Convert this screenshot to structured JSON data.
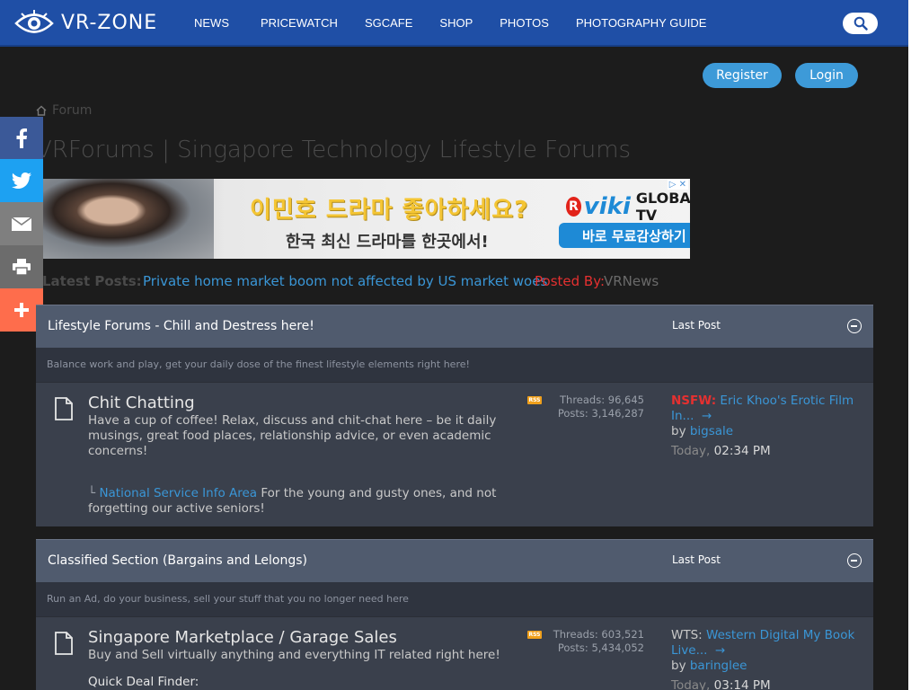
{
  "nav": {
    "logo_text": "VR-ZONE",
    "items": [
      "NEWS",
      "PRICEWATCH",
      "SGCAFE",
      "SHOP",
      "PHOTOS",
      "PHOTOGRAPHY GUIDE"
    ]
  },
  "auth": {
    "register": "Register",
    "login": "Login"
  },
  "breadcrumb": {
    "label": "Forum"
  },
  "page_title": "VRForums | Singapore Technology Lifestyle Forums",
  "ad": {
    "headline": "이민호 드라마 좋아하세요?",
    "sub": "한국 최신 드라마를 한곳에서!",
    "brand_r": "R",
    "brand_viki": "viki",
    "brand_tv": "GLOBAL TV",
    "cta": "바로 무료감상하기",
    "cta_arrow": "▶",
    "adchoice": "▷ ✕"
  },
  "latest": {
    "label": "Latest Posts:",
    "link": "Private home market boom not affected by US market woes",
    "posted_by": "Posted By:",
    "author": "VRNews"
  },
  "sections": [
    {
      "title": "Lifestyle Forums - Chill and Destress here!",
      "last_post_label": "Last Post",
      "description": "Balance work and play, get your daily dose of the finest lifestyle elements right here!",
      "forum": {
        "name": "Chit Chatting",
        "desc": "Have a cup of coffee! Relax, discuss and chit-chat here – be it daily musings, great food places, relationship advice, or even academic concerns!",
        "threads": "Threads: 96,645",
        "posts": "Posts: 3,146,287",
        "lp_prefix": "NSFW:",
        "lp_title": "Eric Khoo's Erotic Film In...",
        "lp_by": "by",
        "lp_user": "bigsale",
        "lp_day": "Today,",
        "lp_time": "02:34 PM",
        "sub_marker": "└",
        "sub_link": "National Service Info Area",
        "sub_text": "For the young and gusty ones, and not forgetting our active seniors!"
      }
    },
    {
      "title": "Classified Section (Bargains and Lelongs)",
      "last_post_label": "Last Post",
      "description": "Run an Ad, do your business, sell your stuff that you no longer need here",
      "forum": {
        "name": "Singapore Marketplace / Garage Sales",
        "desc": "Buy and Sell virtually anything and everything IT related right here!",
        "threads": "Threads: 603,521",
        "posts": "Posts: 5,434,052",
        "lp_prefix": "WTS:",
        "lp_title": "Western Digital My Book Live...",
        "lp_by": "by",
        "lp_user": "baringlee",
        "lp_day": "Today,",
        "lp_time": "03:14 PM",
        "quick": "Quick Deal Finder:"
      }
    }
  ],
  "rss_label": "RSS",
  "colors": {
    "nav_bg": "#1f4fa6",
    "accent": "#3d9ad8",
    "section_head": "#505b6e"
  }
}
